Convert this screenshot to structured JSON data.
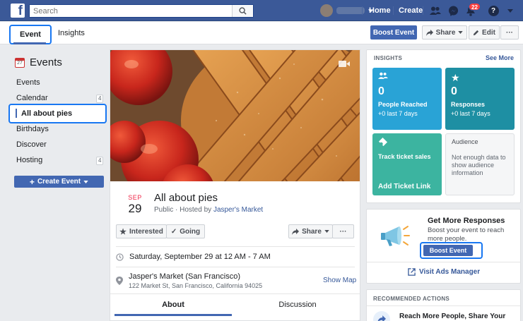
{
  "topbar": {
    "logo": "f",
    "search_placeholder": "Search",
    "user_name": "",
    "home": "Home",
    "create": "Create",
    "notifications_count": "22",
    "help": "?"
  },
  "subbar": {
    "tab_event": "Event",
    "tab_insights": "Insights",
    "boost_event": "Boost Event",
    "share": "Share",
    "edit": "Edit",
    "more": "···"
  },
  "sidebar": {
    "title": "Events",
    "cal_icon_text": "27",
    "items": [
      {
        "label": "Events",
        "count": ""
      },
      {
        "label": "Calendar",
        "count": "4"
      },
      {
        "label": "All about pies",
        "count": ""
      },
      {
        "label": "Birthdays",
        "count": ""
      },
      {
        "label": "Discover",
        "count": ""
      },
      {
        "label": "Hosting",
        "count": "4"
      }
    ],
    "create_event": "Create Event"
  },
  "event": {
    "month": "SEP",
    "day": "29",
    "title": "All about pies",
    "privacy": "Public · Hosted by ",
    "host": "Jasper's Market",
    "interested": "Interested",
    "going": "Going",
    "share": "Share",
    "more": "···",
    "datetime": "Saturday, September 29 at 12 AM - 7 AM",
    "location_name": "Jasper's Market (San Francisco)",
    "location_address": "122 Market St, San Francisco, California 94025",
    "show_map": "Show Map",
    "tab_about": "About",
    "tab_discussion": "Discussion"
  },
  "insights": {
    "heading": "INSIGHTS",
    "see_more": "See More",
    "people_reached_num": "0",
    "people_reached_label": "People Reached",
    "people_reached_delta": "+0 last 7 days",
    "responses_num": "0",
    "responses_label": "Responses",
    "responses_delta": "+0 last 7 days",
    "ticket_title": "Track ticket sales",
    "ticket_link": "Add Ticket Link",
    "audience_title": "Audience",
    "audience_desc": "Not enough data to show audience information"
  },
  "promo": {
    "title": "Get More Responses",
    "desc": "Boost your event to reach more people.",
    "boost": "Boost Event",
    "visit": "Visit Ads Manager"
  },
  "recommended": {
    "heading": "RECOMMENDED ACTIONS",
    "item": "Reach More People, Share Your"
  },
  "colors": {
    "brand": "#3b5998",
    "button_blue": "#4267b2",
    "tile_blue": "#29a3d6",
    "tile_teal": "#1e8fa3",
    "tile_green": "#3cb4a0",
    "highlight": "#1877f2"
  }
}
